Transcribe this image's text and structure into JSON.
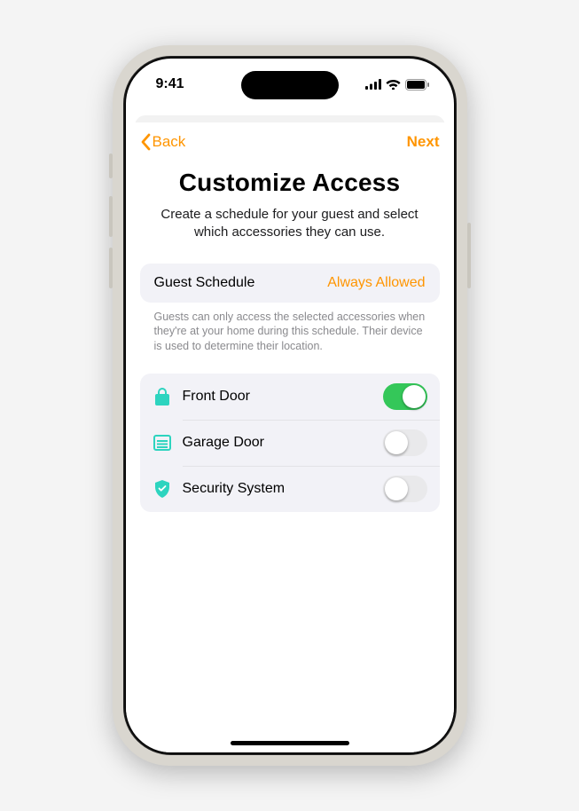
{
  "status": {
    "time": "9:41"
  },
  "nav": {
    "back": "Back",
    "next": "Next"
  },
  "header": {
    "title": "Customize Access",
    "subtitle": "Create a schedule for your guest and select which accessories they can use."
  },
  "schedule": {
    "label": "Guest Schedule",
    "value": "Always Allowed",
    "note": "Guests can only access the selected accessories when they're at your home during this schedule. Their device is used to determine their location."
  },
  "accessories": [
    {
      "icon": "lock",
      "label": "Front Door",
      "on": true
    },
    {
      "icon": "garage",
      "label": "Garage Door",
      "on": false
    },
    {
      "icon": "shield",
      "label": "Security System",
      "on": false
    }
  ],
  "colors": {
    "accent": "#ff9500",
    "teal": "#2dd4bf",
    "toggle_on": "#34c759"
  }
}
